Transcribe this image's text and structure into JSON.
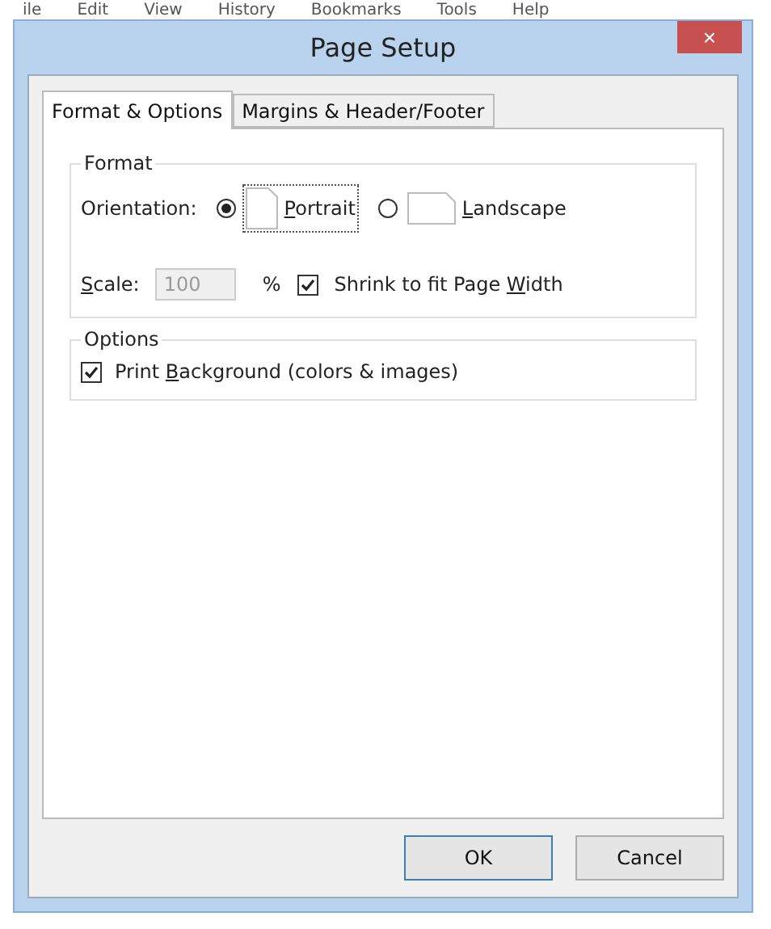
{
  "background_menu": [
    "ile",
    "Edit",
    "View",
    "History",
    "Bookmarks",
    "Tools",
    "Help"
  ],
  "window": {
    "title": "Page Setup",
    "close": "×"
  },
  "tabs": [
    {
      "label": "Format & Options",
      "selected": true
    },
    {
      "label": "Margins & Header/Footer",
      "selected": false
    }
  ],
  "format": {
    "legend": "Format",
    "orientation_label": "Orientation:",
    "orientations": [
      {
        "label": {
          "key": "P",
          "after": "ortrait"
        },
        "selected": true,
        "kind": "portrait"
      },
      {
        "label": {
          "key": "L",
          "after": "andscape"
        },
        "selected": false,
        "kind": "landscape"
      }
    ],
    "scale_label": {
      "key": "S",
      "after": "cale:"
    },
    "scale_value": "100",
    "scale_disabled": true,
    "percent": "%",
    "shrink": {
      "label": {
        "before": "Shrink to fit Page ",
        "key": "W",
        "after": "idth"
      },
      "checked": true
    }
  },
  "options": {
    "legend": "Options",
    "print_background": {
      "label": {
        "before": "Print ",
        "key": "B",
        "after": "ackground (colors & images)"
      },
      "checked": true
    }
  },
  "buttons": [
    {
      "label": "OK",
      "default": true
    },
    {
      "label": "Cancel",
      "default": false
    }
  ]
}
